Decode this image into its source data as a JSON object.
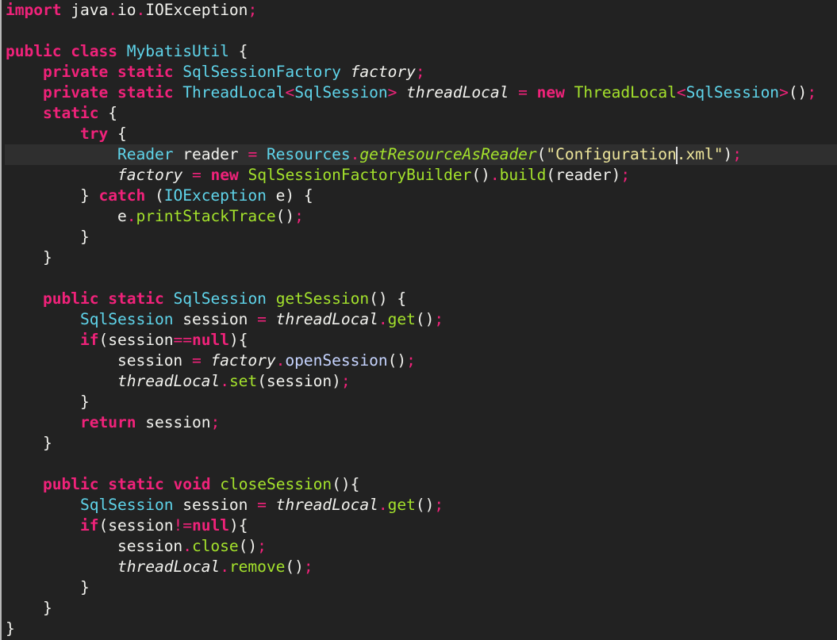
{
  "editor": {
    "language": "Java",
    "current_line": 8,
    "colors": {
      "background": "#222222",
      "keyword": "#f0227a",
      "type": "#5fd4ea",
      "function": "#a4e22c",
      "string": "#ece49a",
      "text": "#f2f2ee"
    },
    "lines": [
      [
        [
          "import",
          "k"
        ],
        [
          " java",
          "n"
        ],
        [
          ".",
          "p"
        ],
        [
          "io",
          "n"
        ],
        [
          ".",
          "p"
        ],
        [
          "IOException",
          "n"
        ],
        [
          ";",
          "p"
        ]
      ],
      [],
      [
        [
          "public",
          "k"
        ],
        [
          " ",
          "n"
        ],
        [
          "class",
          "k"
        ],
        [
          " ",
          "n"
        ],
        [
          "MybatisUtil",
          "t"
        ],
        [
          " {",
          "n"
        ]
      ],
      [
        [
          "    ",
          "n"
        ],
        [
          "private",
          "k"
        ],
        [
          " ",
          "n"
        ],
        [
          "static",
          "k"
        ],
        [
          " ",
          "n"
        ],
        [
          "SqlSessionFactory",
          "t"
        ],
        [
          " ",
          "n"
        ],
        [
          "factory",
          "v"
        ],
        [
          ";",
          "p"
        ]
      ],
      [
        [
          "    ",
          "n"
        ],
        [
          "private",
          "k"
        ],
        [
          " ",
          "n"
        ],
        [
          "static",
          "k"
        ],
        [
          " ",
          "n"
        ],
        [
          "ThreadLocal",
          "t"
        ],
        [
          "<",
          "p"
        ],
        [
          "SqlSession",
          "t"
        ],
        [
          ">",
          "p"
        ],
        [
          " ",
          "n"
        ],
        [
          "threadLocal",
          "v"
        ],
        [
          " ",
          "n"
        ],
        [
          "=",
          "p"
        ],
        [
          " ",
          "n"
        ],
        [
          "new",
          "k"
        ],
        [
          " ",
          "n"
        ],
        [
          "ThreadLocal",
          "f"
        ],
        [
          "<",
          "p"
        ],
        [
          "SqlSession",
          "t"
        ],
        [
          ">",
          "p"
        ],
        [
          "()",
          "n"
        ],
        [
          ";",
          "p"
        ]
      ],
      [
        [
          "    ",
          "n"
        ],
        [
          "static",
          "k"
        ],
        [
          " {",
          "n"
        ]
      ],
      [
        [
          "        ",
          "n"
        ],
        [
          "try",
          "k"
        ],
        [
          " {",
          "n"
        ]
      ],
      [
        [
          "            ",
          "n"
        ],
        [
          "Reader",
          "t"
        ],
        [
          " reader ",
          "n"
        ],
        [
          "=",
          "p"
        ],
        [
          " ",
          "n"
        ],
        [
          "Resources",
          "t"
        ],
        [
          ".",
          "p"
        ],
        [
          "getResourceAsReader",
          "fi"
        ],
        [
          "(",
          "n"
        ],
        [
          "\"Configuration",
          "s"
        ],
        [
          "|",
          "caret"
        ],
        [
          ".xml\"",
          "s"
        ],
        [
          ")",
          "n"
        ],
        [
          ";",
          "p"
        ]
      ],
      [
        [
          "            ",
          "n"
        ],
        [
          "factory",
          "v"
        ],
        [
          " ",
          "n"
        ],
        [
          "=",
          "p"
        ],
        [
          " ",
          "n"
        ],
        [
          "new",
          "k"
        ],
        [
          " ",
          "n"
        ],
        [
          "SqlSessionFactoryBuilder",
          "f"
        ],
        [
          "()",
          "n"
        ],
        [
          ".",
          "p"
        ],
        [
          "build",
          "f"
        ],
        [
          "(reader)",
          "n"
        ],
        [
          ";",
          "p"
        ]
      ],
      [
        [
          "        } ",
          "n"
        ],
        [
          "catch",
          "k"
        ],
        [
          " (",
          "n"
        ],
        [
          "IOException",
          "t"
        ],
        [
          " e) {",
          "n"
        ]
      ],
      [
        [
          "            e",
          "n"
        ],
        [
          ".",
          "p"
        ],
        [
          "printStackTrace",
          "f"
        ],
        [
          "()",
          "n"
        ],
        [
          ";",
          "p"
        ]
      ],
      [
        [
          "        }",
          "n"
        ]
      ],
      [
        [
          "    }",
          "n"
        ]
      ],
      [],
      [
        [
          "    ",
          "n"
        ],
        [
          "public",
          "k"
        ],
        [
          " ",
          "n"
        ],
        [
          "static",
          "k"
        ],
        [
          " ",
          "n"
        ],
        [
          "SqlSession",
          "t"
        ],
        [
          " ",
          "n"
        ],
        [
          "getSession",
          "f"
        ],
        [
          "() {",
          "n"
        ]
      ],
      [
        [
          "        ",
          "n"
        ],
        [
          "SqlSession",
          "t"
        ],
        [
          " session ",
          "n"
        ],
        [
          "=",
          "p"
        ],
        [
          " ",
          "n"
        ],
        [
          "threadLocal",
          "v"
        ],
        [
          ".",
          "p"
        ],
        [
          "get",
          "f"
        ],
        [
          "()",
          "n"
        ],
        [
          ";",
          "p"
        ]
      ],
      [
        [
          "        ",
          "n"
        ],
        [
          "if",
          "k"
        ],
        [
          "(session",
          "n"
        ],
        [
          "==",
          "p"
        ],
        [
          "null",
          "k"
        ],
        [
          "){",
          "n"
        ]
      ],
      [
        [
          "            session ",
          "n"
        ],
        [
          "=",
          "p"
        ],
        [
          " ",
          "n"
        ],
        [
          "factory",
          "v"
        ],
        [
          ".",
          "p"
        ],
        [
          "openSession",
          "m"
        ],
        [
          "()",
          "n"
        ],
        [
          ";",
          "p"
        ]
      ],
      [
        [
          "            ",
          "n"
        ],
        [
          "threadLocal",
          "v"
        ],
        [
          ".",
          "p"
        ],
        [
          "set",
          "f"
        ],
        [
          "(session)",
          "n"
        ],
        [
          ";",
          "p"
        ]
      ],
      [
        [
          "        }",
          "n"
        ]
      ],
      [
        [
          "        ",
          "n"
        ],
        [
          "return",
          "k"
        ],
        [
          " session",
          "n"
        ],
        [
          ";",
          "p"
        ]
      ],
      [
        [
          "    }",
          "n"
        ]
      ],
      [],
      [
        [
          "    ",
          "n"
        ],
        [
          "public",
          "k"
        ],
        [
          " ",
          "n"
        ],
        [
          "static",
          "k"
        ],
        [
          " ",
          "n"
        ],
        [
          "void",
          "k"
        ],
        [
          " ",
          "n"
        ],
        [
          "closeSession",
          "f"
        ],
        [
          "(){",
          "n"
        ]
      ],
      [
        [
          "        ",
          "n"
        ],
        [
          "SqlSession",
          "t"
        ],
        [
          " session ",
          "n"
        ],
        [
          "=",
          "p"
        ],
        [
          " ",
          "n"
        ],
        [
          "threadLocal",
          "v"
        ],
        [
          ".",
          "p"
        ],
        [
          "get",
          "f"
        ],
        [
          "()",
          "n"
        ],
        [
          ";",
          "p"
        ]
      ],
      [
        [
          "        ",
          "n"
        ],
        [
          "if",
          "k"
        ],
        [
          "(session",
          "n"
        ],
        [
          "!=",
          "p"
        ],
        [
          "null",
          "k"
        ],
        [
          "){",
          "n"
        ]
      ],
      [
        [
          "            session",
          "n"
        ],
        [
          ".",
          "p"
        ],
        [
          "close",
          "f"
        ],
        [
          "()",
          "n"
        ],
        [
          ";",
          "p"
        ]
      ],
      [
        [
          "            ",
          "n"
        ],
        [
          "threadLocal",
          "v"
        ],
        [
          ".",
          "p"
        ],
        [
          "remove",
          "f"
        ],
        [
          "()",
          "n"
        ],
        [
          ";",
          "p"
        ]
      ],
      [
        [
          "        }",
          "n"
        ]
      ],
      [
        [
          "    }",
          "n"
        ]
      ],
      [
        [
          "}",
          "n"
        ]
      ]
    ]
  }
}
